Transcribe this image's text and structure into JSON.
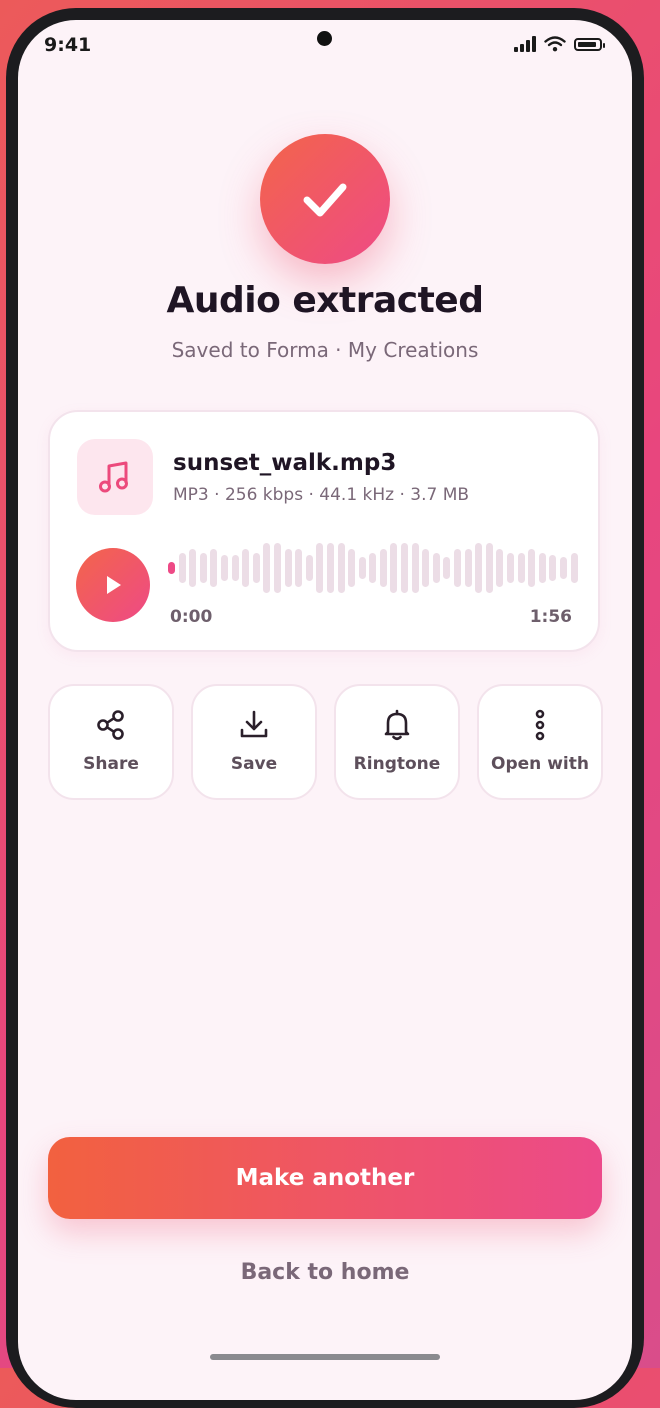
{
  "status_bar": {
    "time": "9:41"
  },
  "header": {
    "title": "Audio extracted",
    "subtitle": "Saved to Forma · My Creations"
  },
  "file": {
    "name": "sunset_walk.mp3",
    "meta": "MP3 · 256 kbps · 44.1 kHz · 3.7 MB",
    "current_time": "0:00",
    "duration": "1:56",
    "progress": 0
  },
  "actions": [
    {
      "label": "Share",
      "icon": "share-icon"
    },
    {
      "label": "Save",
      "icon": "download-icon"
    },
    {
      "label": "Ringtone",
      "icon": "bell-icon"
    },
    {
      "label": "Open with",
      "icon": "more-vertical-icon"
    }
  ],
  "primary_button": {
    "label": "Make another"
  },
  "secondary_link": {
    "label": "Back to home"
  },
  "colors": {
    "accent_start": "#f2613f",
    "accent_end": "#ec4a8a",
    "background": "#fdf3f8"
  }
}
